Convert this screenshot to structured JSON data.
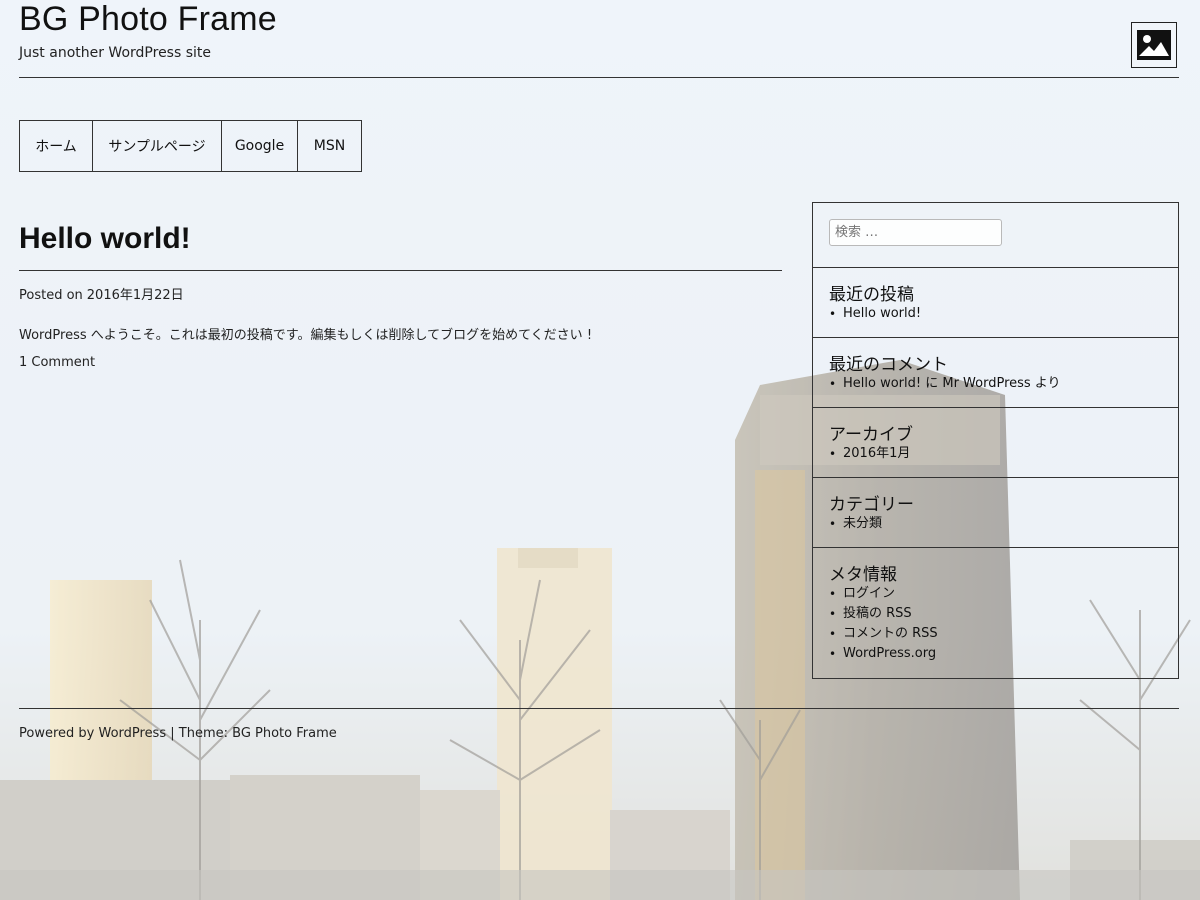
{
  "site": {
    "title": "BG Photo Frame",
    "description": "Just another WordPress site"
  },
  "nav": [
    {
      "label": "ホーム"
    },
    {
      "label": "サンプルページ"
    },
    {
      "label": "Google"
    },
    {
      "label": "MSN"
    }
  ],
  "post": {
    "title": "Hello world!",
    "posted_label": "Posted on",
    "date": "2016年1月22日",
    "body": "WordPress へようこそ。これは最初の投稿です。編集もしくは削除してブログを始めてください !",
    "comments": "1 Comment"
  },
  "sidebar": {
    "search_placeholder": "検索 …",
    "widgets": [
      {
        "title": "最近の投稿",
        "items": [
          "Hello world!"
        ]
      },
      {
        "title": "最近のコメント",
        "items": [
          "Hello world! に Mr WordPress より"
        ]
      },
      {
        "title": "アーカイブ",
        "items": [
          "2016年1月"
        ]
      },
      {
        "title": "カテゴリー",
        "items": [
          "未分類"
        ]
      },
      {
        "title": "メタ情報",
        "items": [
          "ログイン",
          "投稿の RSS",
          "コメントの RSS",
          "WordPress.org"
        ]
      }
    ]
  },
  "footer": {
    "powered": "Powered by WordPress",
    "separator": "|",
    "theme": "Theme: BG Photo Frame"
  },
  "icons": {
    "header": "image-icon"
  },
  "colors": {
    "text": "#111111",
    "border": "#333333",
    "sky": "#dde8f3"
  }
}
